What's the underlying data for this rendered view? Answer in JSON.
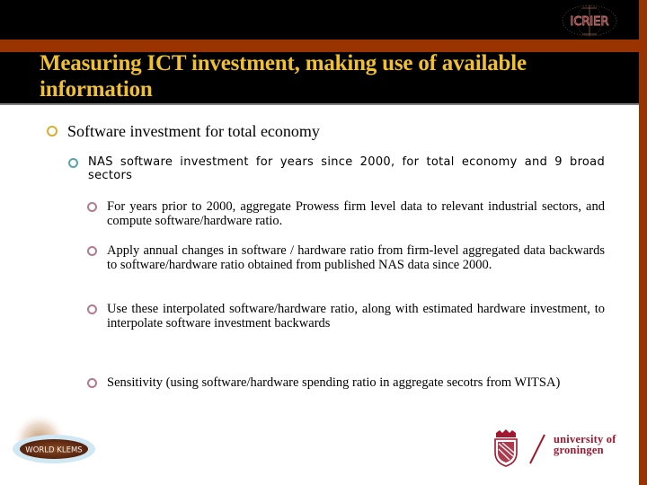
{
  "slide": {
    "title": "Measuring ICT investment, making use of available information",
    "colors": {
      "title_text": "#f0c030",
      "header_background": "#000000",
      "accent_band": "#993300",
      "bullet_level1": "#d4b030",
      "bullet_level2": "#5ba3a9",
      "bullet_level3": "#b57a8e",
      "groningen_red": "#a0172e"
    }
  },
  "logos": {
    "top_right": {
      "text": "ICRIER",
      "icon": "icrier-globe-logo"
    },
    "bottom_left": {
      "text": "WORLD KLEMS",
      "icon": "world-klems-oval-logo"
    },
    "bottom_right": {
      "line1": "university of",
      "line2": "groningen",
      "icon": "groningen-crest"
    }
  },
  "bullets": {
    "level1": {
      "text": "Software investment for total economy",
      "icon": "hollow-circle-bullet"
    },
    "level2": {
      "text": "NAS software  investment for years since 2000, for total economy and 9 broad sectors",
      "icon": "hollow-circle-bullet"
    },
    "level3": [
      {
        "text": "For years prior to 2000,  aggregate Prowess firm level data to relevant industrial sectors, and  compute software/hardware ratio.",
        "icon": "hollow-circle-bullet"
      },
      {
        "text": "Apply annual changes in software / hardware ratio from firm-level aggregated data backwards to software/hardware ratio obtained from published NAS data since 2000.",
        "icon": "hollow-circle-bullet"
      },
      {
        "text": "Use these interpolated software/hardware ratio, along with estimated hardware investment, to interpolate software investment backwards",
        "icon": "hollow-circle-bullet"
      },
      {
        "text": "Sensitivity (using software/hardware spending ratio in aggregate secotrs from WITSA)",
        "icon": "hollow-circle-bullet"
      }
    ]
  }
}
